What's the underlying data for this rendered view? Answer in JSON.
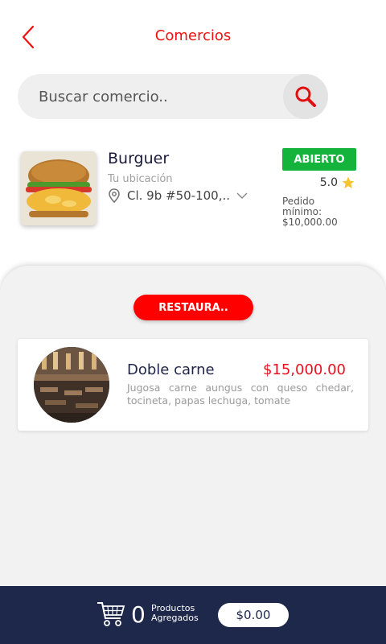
{
  "header": {
    "title": "Comercios",
    "back_icon": "chevron-left-icon",
    "accent_color": "#f01010"
  },
  "search": {
    "placeholder": "Buscar comercio..",
    "value": "",
    "button_icon": "search-icon"
  },
  "store": {
    "name": "Burguer",
    "location_label": "Tu ubicación",
    "address": "Cl. 9b #50-100,..",
    "status": "ABIERTO",
    "status_color": "#14b43c",
    "rating": "5.0",
    "min_order_label": "Pedido mínimo:",
    "min_order_value": "$10,000.00"
  },
  "category": {
    "label": "RESTAURA.."
  },
  "products": [
    {
      "name": "Doble carne",
      "price": "$15,000.00",
      "description": "Jugosa carne aungus con queso chedar, tocineta, papas lechuga, tomate"
    }
  ],
  "cart": {
    "count": "0",
    "label_line1": "Productos",
    "label_line2": "Agregados",
    "total": "$0.00",
    "bar_color": "#1e284a"
  }
}
